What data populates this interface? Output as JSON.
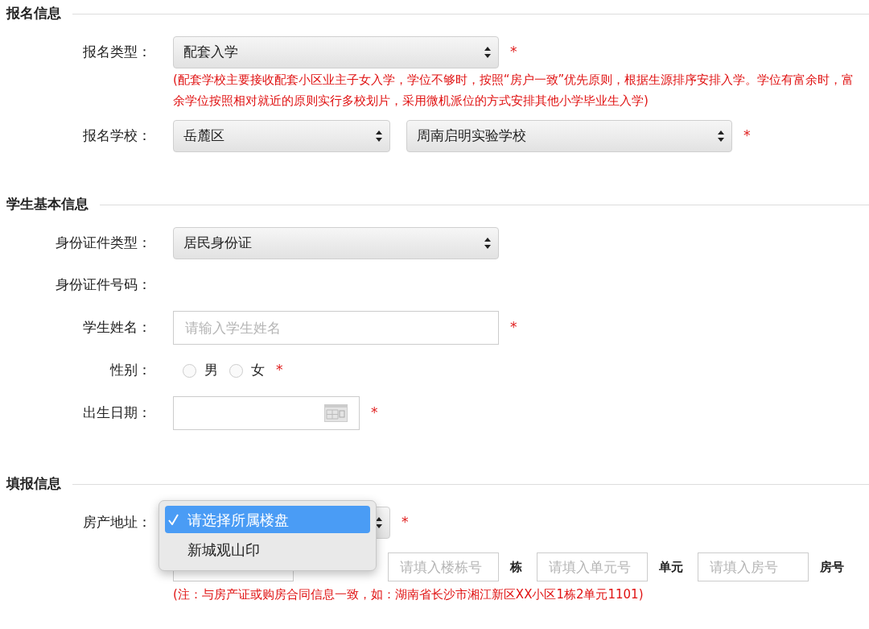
{
  "sections": [
    {
      "title": "报名信息",
      "rows": [
        {
          "kind": "select",
          "label": "报名类型：",
          "selects": [
            {
              "value": "配套入学"
            }
          ],
          "required_mark": "*"
        },
        {
          "kind": "note",
          "text": "(配套学校主要接收配套小区业主子女入学，学位不够时，按照“房户一致”优先原则，根据生源排序安排入学。学位有富余时，富余学位按照相对就近的原则实行多校划片，采用微机派位的方式安排其他小学毕业生入学)"
        },
        {
          "kind": "select",
          "label": "报名学校：",
          "selects": [
            {
              "value": "岳麓区"
            },
            {
              "value": "周南启明实验学校"
            }
          ],
          "required_mark": "*"
        }
      ]
    },
    {
      "title": "学生基本信息",
      "rows": [
        {
          "kind": "select",
          "label": "身份证件类型：",
          "selects": [
            {
              "value": "居民身份证"
            }
          ]
        },
        {
          "kind": "text",
          "label": "身份证件号码："
        },
        {
          "kind": "input",
          "label": "学生姓名：",
          "placeholder": "请输入学生姓名",
          "required_mark": "*"
        },
        {
          "kind": "radio",
          "label": "性别：",
          "options": [
            {
              "label": "男",
              "selected": false
            },
            {
              "label": "女",
              "selected": false
            }
          ],
          "required_mark": "*"
        },
        {
          "kind": "date",
          "label": "出生日期：",
          "required_mark": "*"
        }
      ]
    },
    {
      "title": "填报信息",
      "rows": [
        {
          "kind": "dropdown",
          "label": "房产地址：",
          "options": [
            {
              "label": "请选择所属楼盘",
              "selected": true
            },
            {
              "label": "新城观山印",
              "selected": false
            }
          ],
          "required_mark": "*"
        },
        {
          "kind": "address",
          "fields": [
            {
              "kind": "input"
            },
            {
              "kind": "input",
              "placeholder": "请填入楼栋号",
              "unit": "栋"
            },
            {
              "kind": "input",
              "placeholder": "请填入单元号",
              "unit": "单元"
            },
            {
              "kind": "input",
              "placeholder": "请填入房号",
              "unit": "房号"
            }
          ]
        },
        {
          "kind": "note",
          "text": "(注：与房产证或购房合同信息一致，如：湖南省长沙市湘江新区XX小区1栋2单元1101)"
        }
      ]
    }
  ]
}
